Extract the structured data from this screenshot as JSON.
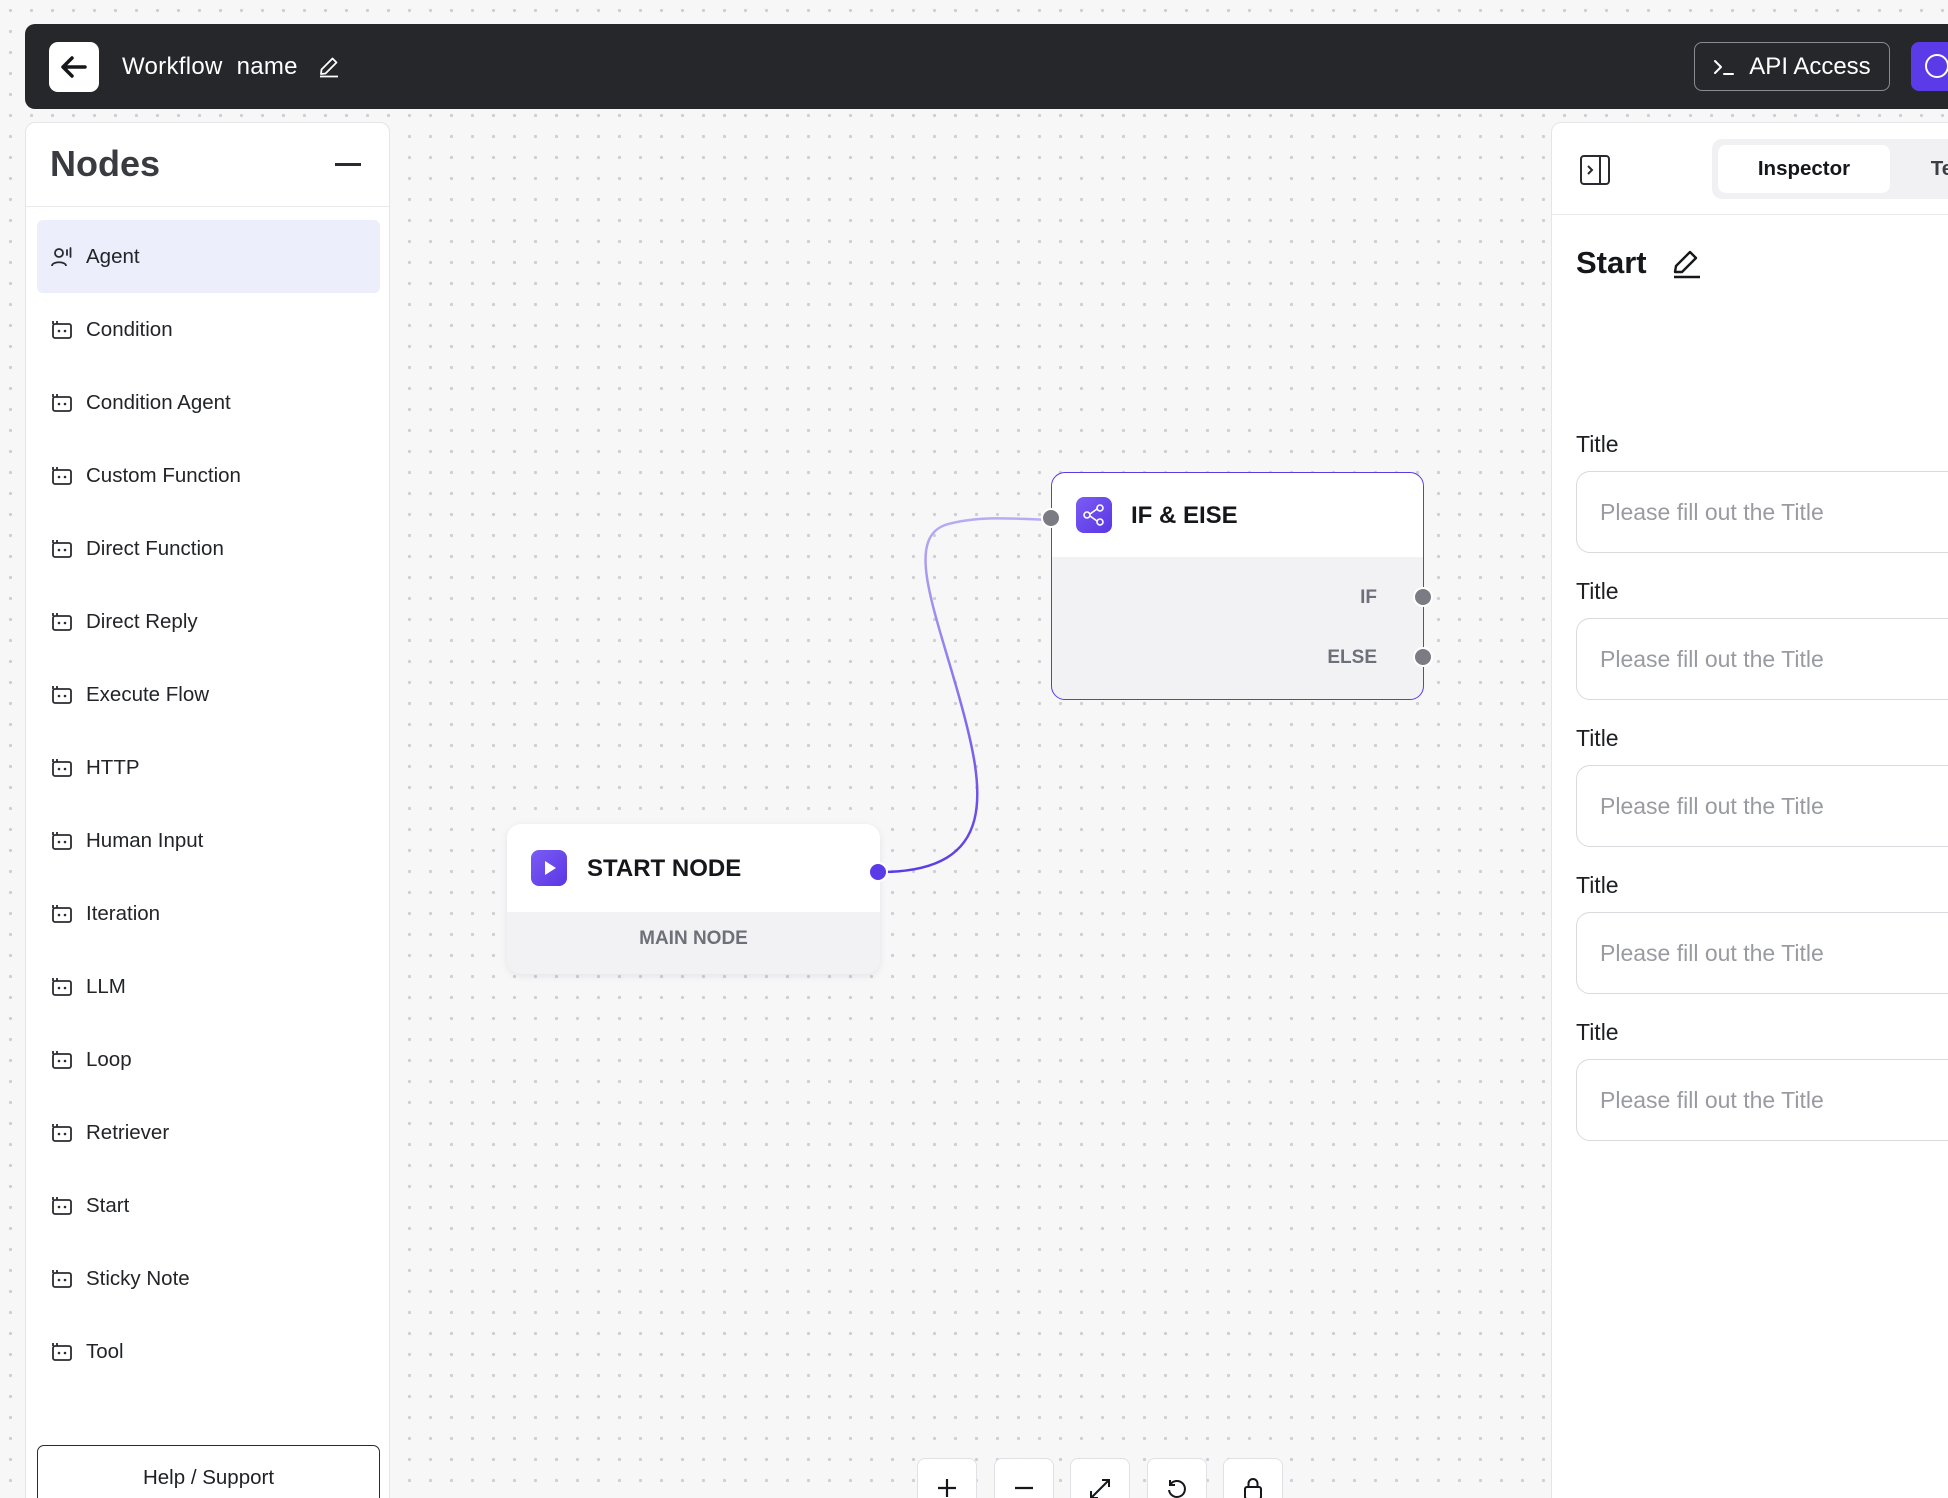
{
  "header": {
    "workflow_name": "Workflow  name",
    "api_access_label": "API Access"
  },
  "nodes_panel": {
    "title": "Nodes",
    "items": [
      {
        "label": "Agent",
        "icon": "agent-icon",
        "active": true
      },
      {
        "label": "Condition",
        "icon": "node-type-icon"
      },
      {
        "label": "Condition Agent",
        "icon": "node-type-icon"
      },
      {
        "label": "Custom Function",
        "icon": "node-type-icon"
      },
      {
        "label": "Direct Function",
        "icon": "node-type-icon"
      },
      {
        "label": "Direct Reply",
        "icon": "node-type-icon"
      },
      {
        "label": "Execute Flow",
        "icon": "node-type-icon"
      },
      {
        "label": "HTTP",
        "icon": "node-type-icon"
      },
      {
        "label": "Human Input",
        "icon": "node-type-icon"
      },
      {
        "label": "Iteration",
        "icon": "node-type-icon"
      },
      {
        "label": "LLM",
        "icon": "node-type-icon"
      },
      {
        "label": "Loop",
        "icon": "node-type-icon"
      },
      {
        "label": "Retriever",
        "icon": "node-type-icon"
      },
      {
        "label": "Start",
        "icon": "node-type-icon"
      },
      {
        "label": "Sticky Note",
        "icon": "node-type-icon"
      },
      {
        "label": "Tool",
        "icon": "node-type-icon"
      }
    ],
    "help_label": "Help / Support"
  },
  "canvas": {
    "start_node": {
      "title": "START NODE",
      "subtitle": "MAIN NODE"
    },
    "if_node": {
      "title": "IF & EISE",
      "if_label": "IF",
      "else_label": "ELSE"
    },
    "toolbar": [
      "zoom-in-icon",
      "zoom-out-icon",
      "fit-view-icon",
      "reset-icon",
      "lock-icon"
    ]
  },
  "inspector": {
    "tabs": [
      "Inspector",
      "Te"
    ],
    "active_tab": "Inspector",
    "node_title": "Start",
    "fields": [
      {
        "label": "Title",
        "placeholder": "Please fill out the Title"
      },
      {
        "label": "Title",
        "placeholder": "Please fill out the Title"
      },
      {
        "label": "Title",
        "placeholder": "Please fill out the Title"
      },
      {
        "label": "Title",
        "placeholder": "Please fill out the Title"
      },
      {
        "label": "Title",
        "placeholder": "Please fill out the Title"
      }
    ]
  },
  "colors": {
    "accent": "#5b3be8",
    "topbar": "#26272b",
    "active_item_bg": "#eceefc"
  }
}
